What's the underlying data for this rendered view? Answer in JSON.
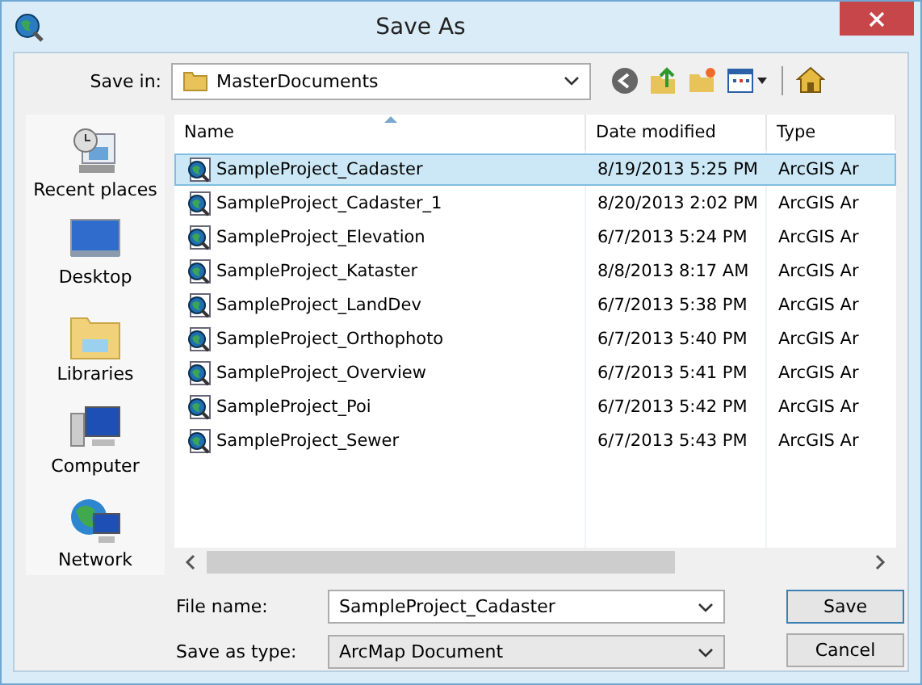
{
  "window": {
    "title": "Save As"
  },
  "save_in": {
    "label": "Save in:",
    "value": "MasterDocuments"
  },
  "places": [
    {
      "label": "Recent places",
      "kind": "recent"
    },
    {
      "label": "Desktop",
      "kind": "desktop"
    },
    {
      "label": "Libraries",
      "kind": "libraries"
    },
    {
      "label": "Computer",
      "kind": "computer"
    },
    {
      "label": "Network",
      "kind": "network"
    }
  ],
  "table": {
    "columns": [
      "Name",
      "Date modified",
      "Type"
    ],
    "rows": [
      {
        "name": "SampleProject_Cadaster",
        "date": "8/19/2013 5:25 PM",
        "type": "ArcGIS Ar",
        "selected": true
      },
      {
        "name": "SampleProject_Cadaster_1",
        "date": "8/20/2013 2:02 PM",
        "type": "ArcGIS Ar",
        "selected": false
      },
      {
        "name": "SampleProject_Elevation",
        "date": "6/7/2013 5:24 PM",
        "type": "ArcGIS Ar",
        "selected": false
      },
      {
        "name": "SampleProject_Kataster",
        "date": "8/8/2013 8:17 AM",
        "type": "ArcGIS Ar",
        "selected": false
      },
      {
        "name": "SampleProject_LandDev",
        "date": "6/7/2013 5:38 PM",
        "type": "ArcGIS Ar",
        "selected": false
      },
      {
        "name": "SampleProject_Orthophoto",
        "date": "6/7/2013 5:40 PM",
        "type": "ArcGIS Ar",
        "selected": false
      },
      {
        "name": "SampleProject_Overview",
        "date": "6/7/2013 5:41 PM",
        "type": "ArcGIS Ar",
        "selected": false
      },
      {
        "name": "SampleProject_Poi",
        "date": "6/7/2013 5:42 PM",
        "type": "ArcGIS Ar",
        "selected": false
      },
      {
        "name": "SampleProject_Sewer",
        "date": "6/7/2013 5:43 PM",
        "type": "ArcGIS Ar",
        "selected": false
      }
    ]
  },
  "file_name": {
    "label": "File name:",
    "value": "SampleProject_Cadaster"
  },
  "save_as_type": {
    "label": "Save as type:",
    "value": "ArcMap Document"
  },
  "buttons": [
    "Save",
    "Cancel"
  ]
}
